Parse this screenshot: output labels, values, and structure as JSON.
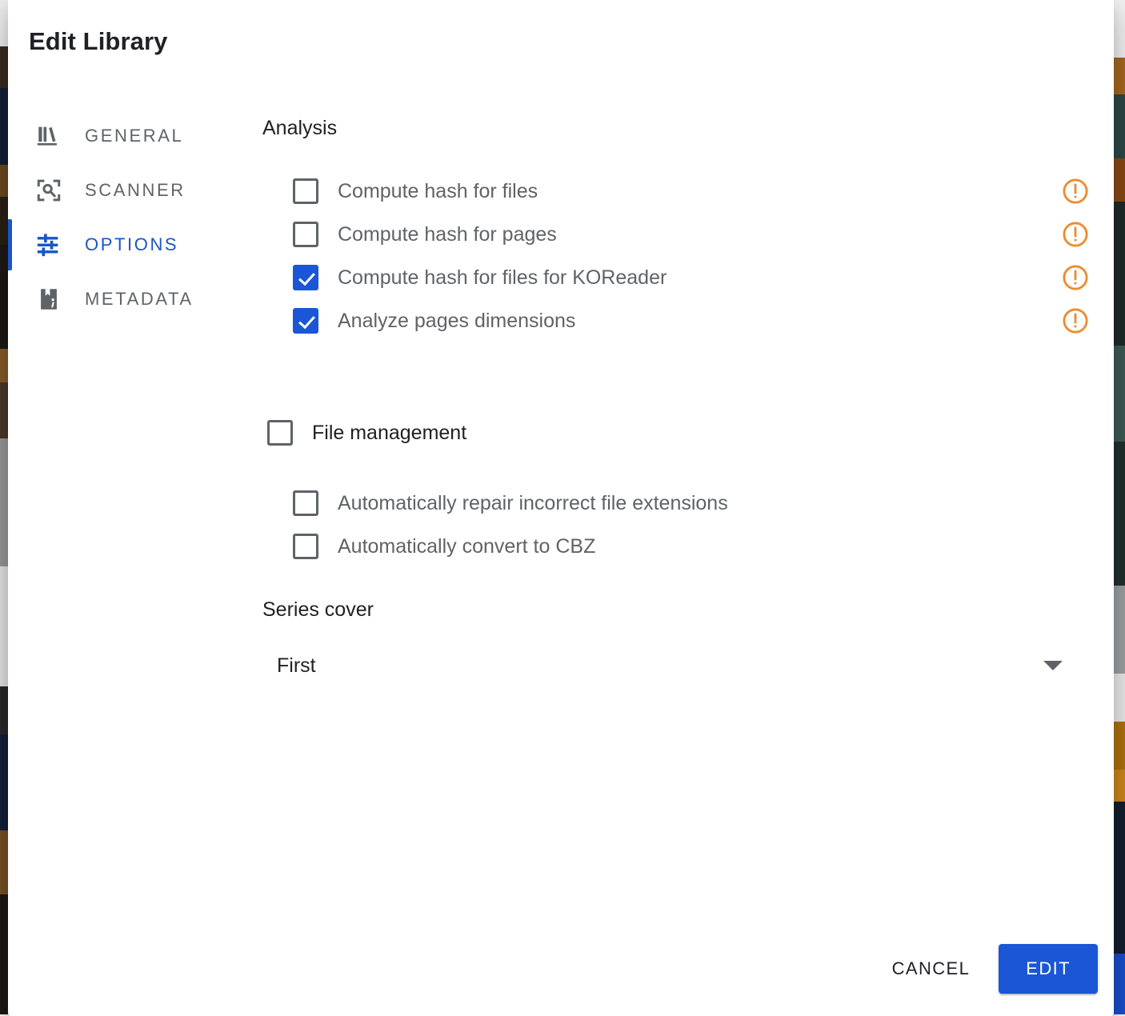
{
  "dialog": {
    "title": "Edit Library"
  },
  "sidebar": {
    "items": [
      {
        "label": "GENERAL",
        "icon": "library-books-icon",
        "active": false
      },
      {
        "label": "SCANNER",
        "icon": "document-scanner-icon",
        "active": false
      },
      {
        "label": "OPTIONS",
        "icon": "tune-sliders-icon",
        "active": true
      },
      {
        "label": "METADATA",
        "icon": "book-info-icon",
        "active": false
      }
    ]
  },
  "content": {
    "analysis": {
      "heading": "Analysis",
      "options": [
        {
          "label": "Compute hash for files",
          "checked": false,
          "warning": true
        },
        {
          "label": "Compute hash for pages",
          "checked": false,
          "warning": true
        },
        {
          "label": "Compute hash for files for KOReader",
          "checked": true,
          "warning": true
        },
        {
          "label": "Analyze pages dimensions",
          "checked": true,
          "warning": true
        }
      ]
    },
    "file_management": {
      "label": "File management",
      "checked": false,
      "options": [
        {
          "label": "Automatically repair incorrect file extensions",
          "checked": false
        },
        {
          "label": "Automatically convert to CBZ",
          "checked": false
        }
      ]
    },
    "series_cover": {
      "label": "Series cover",
      "value": "First",
      "caret": "chevron-down-icon"
    }
  },
  "footer": {
    "cancel_label": "CANCEL",
    "confirm_label": "EDIT"
  },
  "colors": {
    "accent_blue": "#1a56d6",
    "tab_active_blue": "#1a56c4",
    "warning_orange": "#ee8b2d",
    "text_dark": "#202124",
    "text_gray": "#5f6368"
  }
}
